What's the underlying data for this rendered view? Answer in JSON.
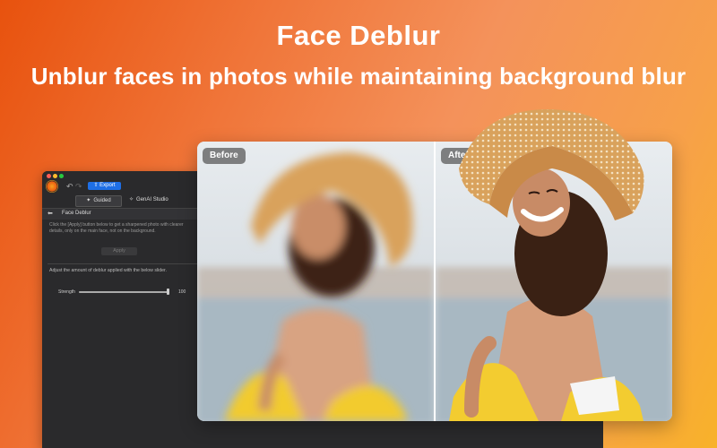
{
  "hero": {
    "title": "Face Deblur",
    "subtitle": "Unblur faces in photos while maintaining background blur"
  },
  "colors": {
    "accent": "#1e6fe6",
    "bg_start": "#e8520e",
    "bg_end": "#f8b22a",
    "app_bg": "#2a2a2c"
  },
  "app": {
    "toolbar": {
      "undo_icon": "undo-icon",
      "redo_icon": "redo-icon",
      "export_label": "Export"
    },
    "tabs": [
      {
        "label": "Guided",
        "icon": "wand-icon",
        "active": true
      },
      {
        "label": "GenAI Studio",
        "icon": "sparkle-icon",
        "active": false
      }
    ],
    "panel": {
      "title": "Face Deblur",
      "description": "Click the [Apply] button below to get a sharpened photo with clearer details, only on the main face, not on the background.",
      "apply_label": "Apply",
      "adjust_text": "Adjust the amount of deblur applied with the below slider.",
      "strength_label": "Strength",
      "strength_value": "100",
      "strength_fraction": 1.0
    }
  },
  "compare": {
    "before_label": "Before",
    "after_label": "After"
  }
}
